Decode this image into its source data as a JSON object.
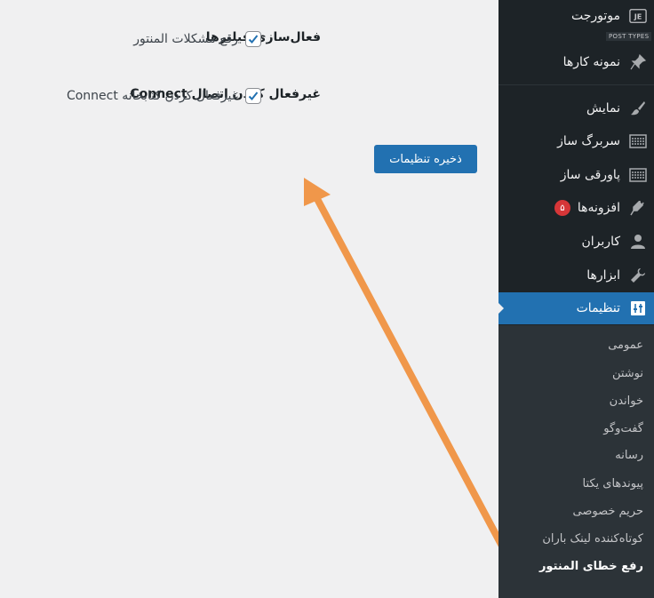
{
  "colors": {
    "sidebar_bg": "#1d2327",
    "submenu_bg": "#2c3338",
    "active_bg": "#2271b1",
    "page_bg": "#f0f0f1",
    "annotation_arrow": "#f0974a",
    "badge": "#d63638"
  },
  "sidebar": {
    "top_item": {
      "label": "موتورجت",
      "icon": "jet-engine-icon"
    },
    "post_types_label": "POST TYPES",
    "items": [
      {
        "label": "نمونه کارها",
        "icon": "pin-icon"
      },
      {
        "label": "نمایش",
        "icon": "paintbrush-icon"
      },
      {
        "label": "سربرگ ساز",
        "icon": "layout-icon"
      },
      {
        "label": "پاورقی ساز",
        "icon": "layout-icon"
      },
      {
        "label": "افزونه‌ها",
        "icon": "plugin-icon",
        "badge": "۵"
      },
      {
        "label": "کاربران",
        "icon": "user-icon"
      },
      {
        "label": "ابزارها",
        "icon": "wrench-icon"
      },
      {
        "label": "تنظیمات",
        "icon": "settings-icon",
        "active": true
      }
    ],
    "submenu": [
      "عمومی",
      "نوشتن",
      "خواندن",
      "گفت‌وگو",
      "رسانه",
      "پیوندهای یکتا",
      "حریم خصوصی",
      "کوتاه‌کننده لینک باران",
      "رفع خطای المنتور"
    ]
  },
  "settings": [
    {
      "label": "فعال‌سازی فیلترها",
      "checkbox_label": "رفع مشکلات المنتور",
      "checked": true
    },
    {
      "label": "غیرفعال کردن اتصال Connect",
      "checkbox_label": "غیرفعال کردن کتابخانه Connect",
      "checked": true
    }
  ],
  "save_button": "ذخیره تنظیمات"
}
